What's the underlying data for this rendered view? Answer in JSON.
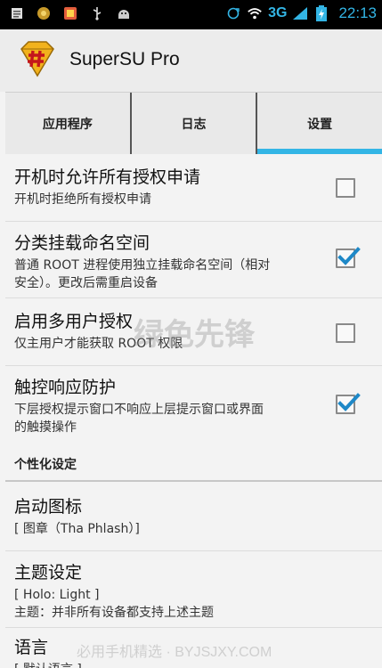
{
  "status_bar": {
    "icons_left": [
      "notes-icon",
      "app-icon",
      "gallery-icon",
      "usb-icon",
      "android-icon"
    ],
    "network": "3G",
    "time": "22:13"
  },
  "app_bar": {
    "title": "SuperSU Pro"
  },
  "tabs": [
    {
      "label": "应用程序",
      "active": false
    },
    {
      "label": "日志",
      "active": false
    },
    {
      "label": "设置",
      "active": true
    }
  ],
  "settings": {
    "items": [
      {
        "title": "开机时允许所有授权申请",
        "summary": "开机时拒绝所有授权申请",
        "checked": false
      },
      {
        "title": "分类挂载命名空间",
        "summary_lines": [
          "普通 ROOT 进程使用独立挂载命名空间（相对",
          "安全）。更改后需重启设备"
        ],
        "checked": true
      },
      {
        "title": "启用多用户授权",
        "summary": "仅主用户才能获取 ROOT 权限",
        "checked": false
      },
      {
        "title": "触控响应防护",
        "summary_lines": [
          "下层授权提示窗口不响应上层提示窗口或界面",
          "的触摸操作"
        ],
        "checked": true
      }
    ],
    "section_header": "个性化设定",
    "personal": [
      {
        "title": "启动图标",
        "summary": "[ 图章（Tha Phlash）]"
      },
      {
        "title": "主题设定",
        "summary_lines": [
          "[ Holo: Light ]",
          "主题：并非所有设备都支持上述主题"
        ]
      },
      {
        "title": "语言",
        "summary": "[ 默认语言 ]"
      }
    ]
  },
  "watermarks": {
    "center": "绿色先锋",
    "bottom": "必用手机精选 · BYJSJXY.COM"
  },
  "colors": {
    "accent": "#33b5e5",
    "check": "#1e88c7"
  }
}
